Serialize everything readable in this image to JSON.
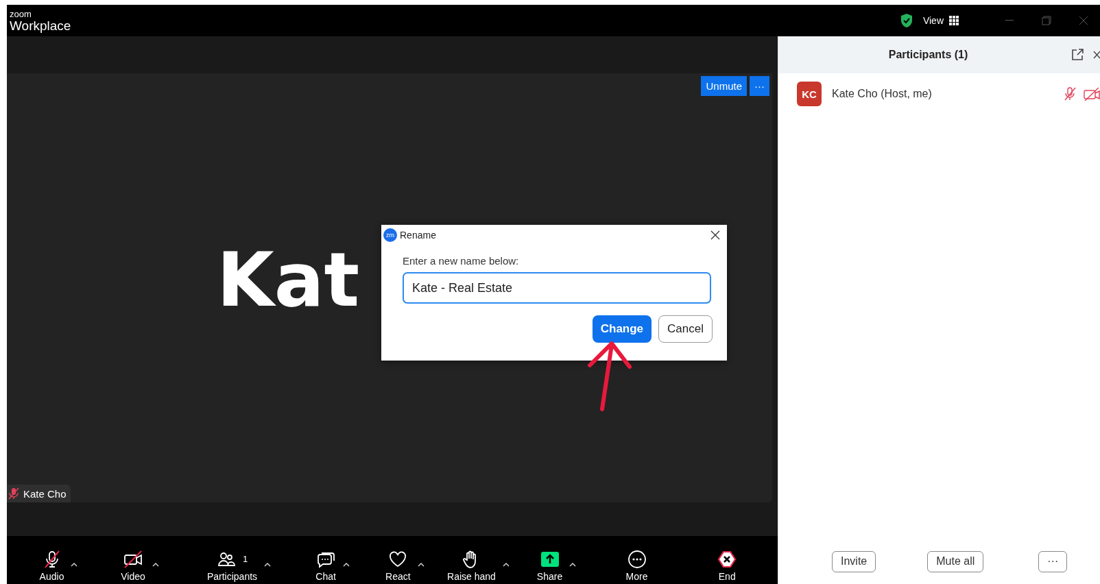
{
  "top_bar": {
    "brand_small": "zoom",
    "brand": "Workplace",
    "view_label": "View"
  },
  "video_tile": {
    "name_big": "Kat",
    "name_tag": "Kate Cho",
    "name_tag_muted": true,
    "unmute_button": "Unmute",
    "more_button": "···"
  },
  "dialog": {
    "title": "Rename",
    "app_badge": "zm",
    "prompt": "Enter a new name below:",
    "value": "Kate - Real Estate",
    "buttons": [
      {
        "label": "Change",
        "primary": true
      },
      {
        "label": "Cancel",
        "primary": false
      }
    ]
  },
  "toolbar": [
    {
      "kind": "audio",
      "label": "Audio",
      "off": true,
      "caret": true
    },
    {
      "kind": "video",
      "label": "Video",
      "off": true,
      "caret": true
    },
    {
      "kind": "participants",
      "label": "Participants",
      "count": "1",
      "off": false,
      "caret": true
    },
    {
      "kind": "chat",
      "label": "Chat",
      "off": false,
      "caret": true
    },
    {
      "kind": "react",
      "label": "React",
      "off": false,
      "caret": true
    },
    {
      "kind": "hand",
      "label": "Raise hand",
      "off": false,
      "caret": true
    },
    {
      "kind": "share",
      "label": "Share",
      "off": false,
      "caret": true
    },
    {
      "kind": "more",
      "label": "More",
      "off": false,
      "caret": false
    },
    {
      "kind": "end",
      "label": "End",
      "off": false,
      "caret": false
    }
  ],
  "participants_panel": {
    "title": "Participants (1)",
    "participants": [
      {
        "initials": "KC",
        "name": "Kate Cho (Host, me)",
        "muted": true,
        "video_off": true
      }
    ],
    "footer_buttons": [
      "Invite",
      "Mute all",
      "···"
    ]
  }
}
